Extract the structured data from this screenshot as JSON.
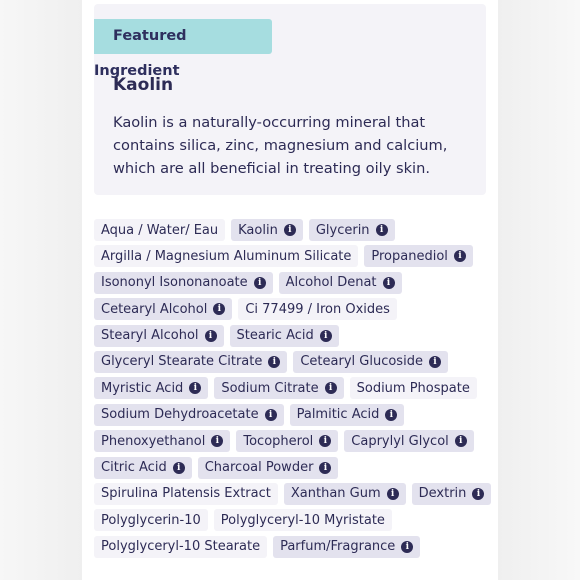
{
  "featured": {
    "badge": "Featured Ingredient",
    "title": "Kaolin",
    "description": "Kaolin is a naturally-occurring mineral that contains silica, zinc, magnesium and calcium, which are all beneficial in treating oily skin."
  },
  "icons": {
    "info": "info-icon"
  },
  "colors": {
    "badge": "#a6dde0",
    "text": "#2d2b55",
    "tag_plain": "#f4f3f8",
    "tag_info": "#e3e2ee"
  },
  "ingredient_rows": [
    [
      {
        "label": "Aqua / Water/ Eau",
        "info": false
      },
      {
        "label": "Kaolin",
        "info": true
      },
      {
        "label": "Glycerin",
        "info": true
      }
    ],
    [
      {
        "label": "Argilla / Magnesium Aluminum Silicate",
        "info": false
      },
      {
        "label": "Propanediol",
        "info": true
      }
    ],
    [
      {
        "label": "Isononyl Isononanoate",
        "info": true
      },
      {
        "label": "Alcohol Denat",
        "info": true
      }
    ],
    [
      {
        "label": "Cetearyl Alcohol",
        "info": true
      },
      {
        "label": "Ci 77499 / Iron Oxides",
        "info": false
      }
    ],
    [
      {
        "label": "Stearyl Alcohol",
        "info": true
      },
      {
        "label": "Stearic Acid",
        "info": true
      }
    ],
    [
      {
        "label": "Glyceryl Stearate Citrate",
        "info": true
      },
      {
        "label": "Cetearyl Glucoside",
        "info": true
      }
    ],
    [
      {
        "label": "Myristic Acid",
        "info": true
      },
      {
        "label": "Sodium Citrate",
        "info": true
      },
      {
        "label": "Sodium Phospate",
        "info": false
      }
    ],
    [
      {
        "label": "Sodium Dehydroacetate",
        "info": true
      },
      {
        "label": "Palmitic Acid",
        "info": true
      }
    ],
    [
      {
        "label": "Phenoxyethanol",
        "info": true
      },
      {
        "label": "Tocopherol",
        "info": true
      },
      {
        "label": "Caprylyl Glycol",
        "info": true
      }
    ],
    [
      {
        "label": "Citric Acid",
        "info": true
      },
      {
        "label": "Charcoal Powder",
        "info": true
      }
    ],
    [
      {
        "label": "Spirulina Platensis Extract",
        "info": false
      },
      {
        "label": "Xanthan Gum",
        "info": true
      },
      {
        "label": "Dextrin",
        "info": true
      }
    ],
    [
      {
        "label": "Polyglycerin-10",
        "info": false
      },
      {
        "label": "Polyglyceryl-10 Myristate",
        "info": false
      }
    ],
    [
      {
        "label": "Polyglyceryl-10 Stearate",
        "info": false
      },
      {
        "label": "Parfum/Fragrance",
        "info": true
      }
    ]
  ]
}
